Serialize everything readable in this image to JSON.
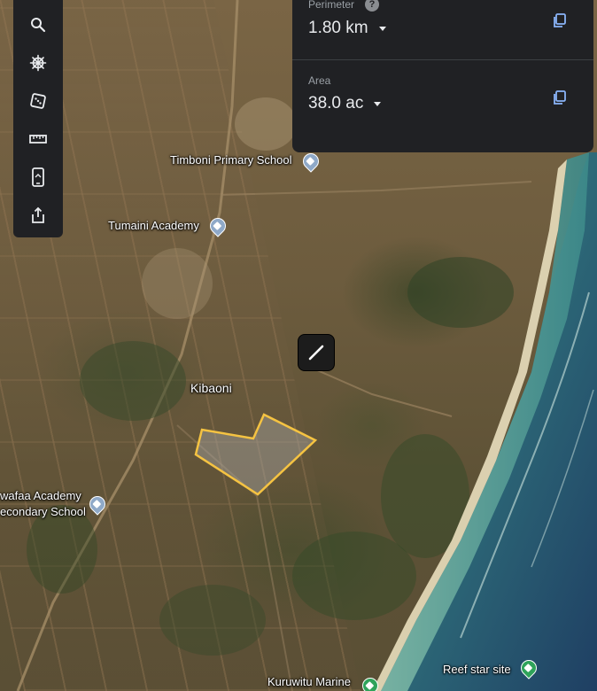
{
  "toolbar": {
    "items": [
      {
        "name": "search"
      },
      {
        "name": "voyager"
      },
      {
        "name": "feeling-lucky"
      },
      {
        "name": "measure"
      },
      {
        "name": "mobile"
      },
      {
        "name": "share"
      }
    ]
  },
  "measure_panel": {
    "perimeter": {
      "label": "Perimeter",
      "help": "?",
      "value": "1.80 km"
    },
    "area": {
      "label": "Area",
      "value": "38.0 ac"
    }
  },
  "map": {
    "places": [
      {
        "name": "Timboni Primary School",
        "type": "school"
      },
      {
        "name": "Tumaini Academy",
        "type": "school"
      },
      {
        "name": "Kibaoni",
        "type": "locality"
      },
      {
        "name_line1": "wafaa Academy",
        "name_line2": "econdary School",
        "type": "school"
      },
      {
        "name": "Reef star site",
        "type": "attraction"
      },
      {
        "name": "Kuruwitu Marine",
        "type": "attraction"
      }
    ],
    "polygon_color": "#f5c342",
    "sea_color": "#2c6f78"
  }
}
